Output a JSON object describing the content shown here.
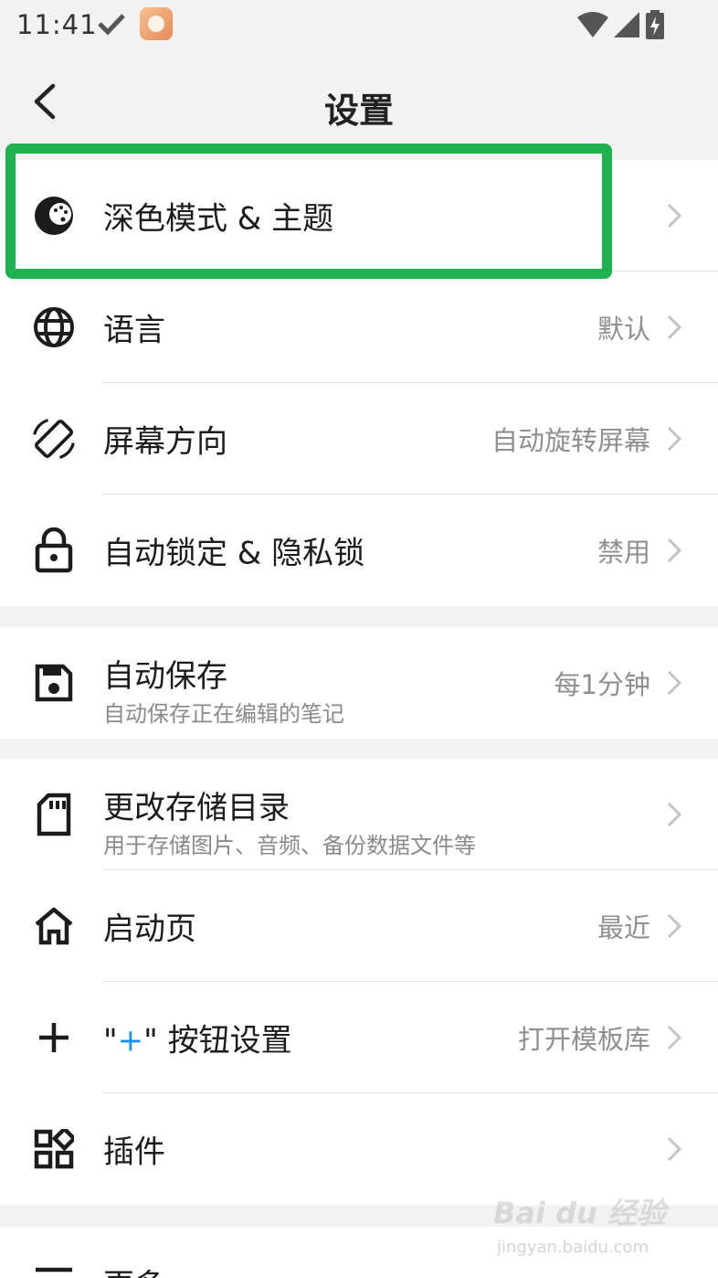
{
  "status_bar": {
    "time": "11:41"
  },
  "header": {
    "title": "设置"
  },
  "sections": [
    {
      "rows": [
        {
          "label": "深色模式 & 主题",
          "value": ""
        },
        {
          "label": "语言",
          "value": "默认"
        },
        {
          "label": "屏幕方向",
          "value": "自动旋转屏幕"
        },
        {
          "label": "自动锁定 & 隐私锁",
          "value": "禁用"
        }
      ]
    },
    {
      "rows": [
        {
          "label": "自动保存",
          "subtitle": "自动保存正在编辑的笔记",
          "value": "每1分钟"
        }
      ]
    },
    {
      "rows": [
        {
          "label": "更改存储目录",
          "subtitle": "用于存储图片、音频、备份数据文件等",
          "value": ""
        },
        {
          "label": "启动页",
          "value": "最近"
        },
        {
          "label_quote_open": "\"",
          "label_plus": "+",
          "label_quote_close": "\"",
          "label_rest": " 按钮设置",
          "value": "打开模板库"
        },
        {
          "label": "插件",
          "value": ""
        }
      ]
    },
    {
      "rows": [
        {
          "label": "更多"
        }
      ]
    }
  ],
  "colors": {
    "highlight": "#1fb14d",
    "accent": "#1a8ee8"
  },
  "watermark": {
    "main": "Bai du 经验",
    "sub": "jingyan.baidu.com"
  }
}
